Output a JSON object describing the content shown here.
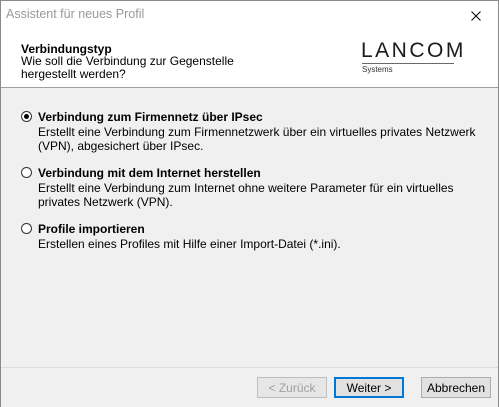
{
  "window": {
    "title": "Assistent für neues Profil"
  },
  "header": {
    "title": "Verbindungstyp",
    "subtitle": "Wie soll die Verbindung zur Gegenstelle hergestellt werden?",
    "logo": {
      "name": "LANCOM",
      "tagline": "Systems"
    }
  },
  "options": [
    {
      "label": "Verbindung zum Firmennetz über IPsec",
      "description": "Erstellt eine Verbindung zum Firmennetzwerk über ein virtuelles privates Netzwerk (VPN), abgesichert über IPsec.",
      "selected": true
    },
    {
      "label": "Verbindung mit dem Internet herstellen",
      "description": "Erstellt eine Verbindung zum Internet ohne weitere Parameter für ein virtuelles privates Netzwerk (VPN).",
      "selected": false
    },
    {
      "label": "Profile importieren",
      "description": "Erstellen eines Profiles mit Hilfe einer Import-Datei (*.ini).",
      "selected": false
    }
  ],
  "buttons": {
    "back": "< Zurück",
    "next": "Weiter >",
    "cancel": "Abbrechen"
  },
  "colors": {
    "dialog_bg": "#f0f0f0",
    "header_bg": "#ffffff",
    "focus_border": "#0078d7"
  }
}
